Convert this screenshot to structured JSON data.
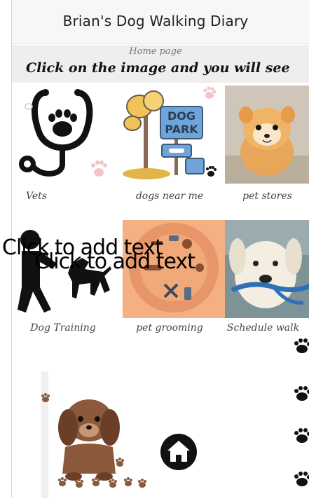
{
  "app": {
    "title": "Brian's Dog Walking Diary"
  },
  "page": {
    "name": "Home page",
    "instruction": "Click on the image and you will see"
  },
  "tiles": [
    {
      "caption": "Vets",
      "icon": "vet-stethoscope-icon"
    },
    {
      "caption": "dogs near me",
      "icon": "dog-park-icon",
      "sign_line1": "DOG",
      "sign_line2": "PARK"
    },
    {
      "caption": "pet stores",
      "icon": "puppy-photo"
    },
    {
      "caption": "Dog Training",
      "icon": "dog-training-icon"
    },
    {
      "caption": "pet grooming",
      "icon": "grooming-icon"
    },
    {
      "caption": "Schedule walk",
      "icon": "dog-with-leash-photo"
    }
  ],
  "placeholders": [
    "Click to add text",
    "Click to add text"
  ],
  "home": {
    "icon": "home-icon"
  },
  "colors": {
    "header_bg": "#eeeeee",
    "title_bar_bg": "#f7f7f7",
    "paw": "#111111",
    "paw_pink": "#f2c6c8"
  }
}
